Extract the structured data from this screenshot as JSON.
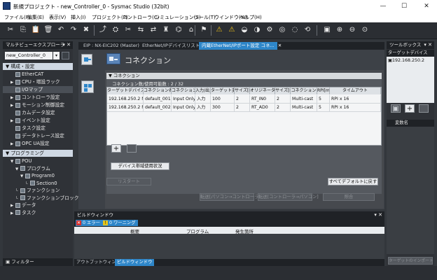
{
  "window": {
    "title": "新規プロジェクト - new_Controller_0 - Sysmac Studio (32bit)",
    "minimize": "—",
    "maximize": "☐",
    "close": "✕"
  },
  "menu": [
    "ファイル(F)",
    "編集(E)",
    "表示(V)",
    "挿入(I)",
    "プロジェクト(P)",
    "コントローラ(C)",
    "シミュレーション(S)",
    "ツール(T)",
    "ウインドウ(W)",
    "ヘルプ(H)"
  ],
  "toolbar": {
    "icons": [
      "✂",
      "⎘",
      "📋",
      "🗑",
      "↶",
      "↷",
      "✖",
      "⤴",
      "⛭",
      "✂",
      "⇆",
      "⇄",
      "♜",
      "⌬",
      "⌂",
      "⚑",
      "⚠",
      "⚠",
      "◒",
      "◑",
      "⚙",
      "◎",
      "◌",
      "⟲",
      "▣",
      "⊕",
      "⊖",
      "⊙"
    ]
  },
  "left_panel": {
    "title": "マルチビューエクスプローラ",
    "pin": "▾ ✕",
    "controller_select": "new_Controller_0",
    "section_config": "▼ 構成・設定",
    "config_items": [
      {
        "label": "EtherCAT",
        "indent": 1,
        "expander": "",
        "selected": false
      },
      {
        "label": "CPU・増設ラック",
        "indent": 1,
        "expander": "▶",
        "selected": false
      },
      {
        "label": "I/Oマップ",
        "indent": 1,
        "expander": "",
        "selected": true
      },
      {
        "label": "コントローラ設定",
        "indent": 1,
        "expander": "▶",
        "selected": false
      },
      {
        "label": "モーション制御設定",
        "indent": 1,
        "expander": "▶",
        "selected": false
      },
      {
        "label": "カムデータ設定",
        "indent": 1,
        "expander": "",
        "selected": false
      },
      {
        "label": "イベント設定",
        "indent": 1,
        "expander": "▶",
        "selected": false
      },
      {
        "label": "タスク設定",
        "indent": 1,
        "expander": "",
        "selected": false
      },
      {
        "label": "データトレース設定",
        "indent": 1,
        "expander": "",
        "selected": false
      },
      {
        "label": "OPC UA設定",
        "indent": 1,
        "expander": "▶",
        "selected": false
      }
    ],
    "section_program": "▼ プログラミング",
    "program_items": [
      {
        "label": "POU",
        "indent": 1,
        "expander": "▼"
      },
      {
        "label": "プログラム",
        "indent": 2,
        "expander": "▼"
      },
      {
        "label": "Program0",
        "indent": 3,
        "expander": "▼"
      },
      {
        "label": "Section0",
        "indent": 4,
        "expander": "└"
      },
      {
        "label": "ファンクション",
        "indent": 2,
        "expander": "└"
      },
      {
        "label": "ファンクションブロック",
        "indent": 2,
        "expander": "└"
      },
      {
        "label": "データ",
        "indent": 1,
        "expander": "▶"
      },
      {
        "label": "タスク",
        "indent": 1,
        "expander": "▶"
      }
    ],
    "filter_label": "フィルター"
  },
  "tabs": [
    {
      "label": "EIP : NX-EIC202 (Master)",
      "active": false
    },
    {
      "label": "EtherNet/IPデバイスリスト",
      "active": false
    },
    {
      "label": "内蔵EtherNet/IPポート設定 コネ...",
      "active": true,
      "close": "✕"
    }
  ],
  "editor": {
    "heading": "コネクション",
    "group_header": "▼ コネクション",
    "summary": "コネクション数/使用可能数 : 2 / 32",
    "columns": [
      "ターゲットデバイス",
      "コネクション名",
      "コネクションI/",
      "入力/出力",
      "ターゲット変数",
      "サイズ[Byte]",
      "オリジネータ変数",
      "サイズ[Byte]",
      "コネクション",
      "RPI[ms]",
      "タイムアウト"
    ],
    "rows": [
      [
        "192.168.250.2 NX-EIC202",
        "default_001",
        "Input Only",
        "入力",
        "100",
        "2",
        "RT_IN0",
        "2",
        "Multi-cast",
        "5",
        "RPI x 16"
      ],
      [
        "192.168.250.2 NX-EIC202",
        "default_002",
        "Input Only",
        "入力",
        "300",
        "2",
        "RT_AD0",
        "2",
        "Multi-cast",
        "5",
        "RPI x 16"
      ]
    ],
    "add_button": "+",
    "delete_button": "",
    "bandwidth_button": "デバイス帯域使用状況",
    "restart_button": "リスタート",
    "reset_defaults_button": "すべてデフォルトに戻す",
    "transfer_to_button": "転送[パソコン→コントローラ]",
    "transfer_from_button": "転送[コントローラ→パソコン]",
    "compare_button": "照合"
  },
  "right_panel": {
    "title": "ツールボックス",
    "pin": "▾ ✕",
    "target_devices_label": "ターゲットデバイス",
    "device": "192.168.250.2",
    "var_name_label": "変数名",
    "add": "+",
    "import_button": "ターゲットのインポート"
  },
  "output_panel": {
    "title": "ビルドウィンドウ",
    "pin": "▾ ✕",
    "errors": "0 エラー",
    "warnings": "0 ワーニング",
    "col_summary": "概要",
    "col_program": "プログラム",
    "col_location": "発生箇所"
  },
  "bottom_tabs": [
    {
      "label": "アウトプットウィンドウ",
      "active": false
    },
    {
      "label": "ビルドウィンドウ",
      "active": true
    }
  ],
  "colors": {
    "accent": "#2e86c9",
    "dark_bg": "#33373c",
    "section_bar": "#cfd8e3",
    "error_badge": "#d9302c",
    "warn_badge": "#e4c41c"
  }
}
